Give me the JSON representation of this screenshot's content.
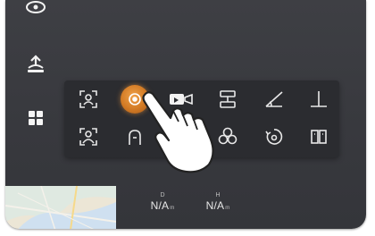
{
  "sidebar": {
    "icons": [
      "camera-icon",
      "return-home-icon",
      "grid-menu-icon"
    ]
  },
  "tool_panel": {
    "row1": [
      "face-detect-icon",
      "point-of-interest-icon",
      "video-record-icon",
      "waypoint-icon",
      "angle-icon",
      "perpendicular-icon"
    ],
    "row2": [
      "portrait-track-icon",
      "gesture-icon",
      "hidden-tool-icon",
      "cluster-icon",
      "orbit-icon",
      "split-view-icon"
    ],
    "active": "point-of-interest-icon"
  },
  "telemetry": {
    "d": {
      "label": "D",
      "value": "N/A",
      "unit": "m"
    },
    "h": {
      "label": "H",
      "value": "N/A",
      "unit": "m"
    }
  },
  "colors": {
    "background": "#3a3b40",
    "panel": "#2b2c30",
    "accent": "#e08a30"
  }
}
